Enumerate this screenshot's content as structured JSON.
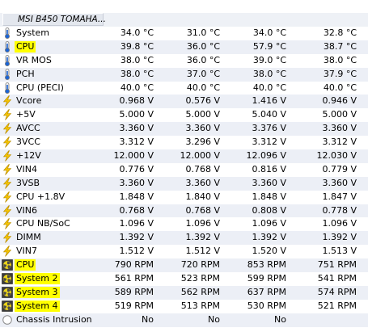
{
  "device": {
    "name": "MSI B450 TOMAHA..."
  },
  "rows": [
    {
      "label": "System",
      "icon": "thermometer-icon",
      "highlight": false,
      "values": [
        "34.0 °C",
        "31.0 °C",
        "34.0 °C",
        "32.8 °C"
      ]
    },
    {
      "label": "CPU",
      "icon": "thermometer-icon",
      "highlight": true,
      "values": [
        "39.8 °C",
        "36.0 °C",
        "57.9 °C",
        "38.7 °C"
      ]
    },
    {
      "label": "VR MOS",
      "icon": "thermometer-icon",
      "highlight": false,
      "values": [
        "38.0 °C",
        "36.0 °C",
        "39.0 °C",
        "38.0 °C"
      ]
    },
    {
      "label": "PCH",
      "icon": "thermometer-icon",
      "highlight": false,
      "values": [
        "38.0 °C",
        "37.0 °C",
        "38.0 °C",
        "37.9 °C"
      ]
    },
    {
      "label": "CPU (PECI)",
      "icon": "thermometer-icon",
      "highlight": false,
      "values": [
        "40.0 °C",
        "40.0 °C",
        "40.0 °C",
        "40.0 °C"
      ]
    },
    {
      "label": "Vcore",
      "icon": "lightning-icon",
      "highlight": false,
      "values": [
        "0.968 V",
        "0.576 V",
        "1.416 V",
        "0.946 V"
      ]
    },
    {
      "label": "+5V",
      "icon": "lightning-icon",
      "highlight": false,
      "values": [
        "5.000 V",
        "5.000 V",
        "5.040 V",
        "5.000 V"
      ]
    },
    {
      "label": "AVCC",
      "icon": "lightning-icon",
      "highlight": false,
      "values": [
        "3.360 V",
        "3.360 V",
        "3.376 V",
        "3.360 V"
      ]
    },
    {
      "label": "3VCC",
      "icon": "lightning-icon",
      "highlight": false,
      "values": [
        "3.312 V",
        "3.296 V",
        "3.312 V",
        "3.312 V"
      ]
    },
    {
      "label": "+12V",
      "icon": "lightning-icon",
      "highlight": false,
      "values": [
        "12.000 V",
        "12.000 V",
        "12.096 V",
        "12.030 V"
      ]
    },
    {
      "label": "VIN4",
      "icon": "lightning-icon",
      "highlight": false,
      "values": [
        "0.776 V",
        "0.768 V",
        "0.816 V",
        "0.779 V"
      ]
    },
    {
      "label": "3VSB",
      "icon": "lightning-icon",
      "highlight": false,
      "values": [
        "3.360 V",
        "3.360 V",
        "3.360 V",
        "3.360 V"
      ]
    },
    {
      "label": "CPU +1.8V",
      "icon": "lightning-icon",
      "highlight": false,
      "values": [
        "1.848 V",
        "1.840 V",
        "1.848 V",
        "1.847 V"
      ]
    },
    {
      "label": "VIN6",
      "icon": "lightning-icon",
      "highlight": false,
      "values": [
        "0.768 V",
        "0.768 V",
        "0.808 V",
        "0.778 V"
      ]
    },
    {
      "label": "CPU NB/SoC",
      "icon": "lightning-icon",
      "highlight": false,
      "values": [
        "1.096 V",
        "1.096 V",
        "1.096 V",
        "1.096 V"
      ]
    },
    {
      "label": "DIMM",
      "icon": "lightning-icon",
      "highlight": false,
      "values": [
        "1.392 V",
        "1.392 V",
        "1.392 V",
        "1.392 V"
      ]
    },
    {
      "label": "VIN7",
      "icon": "lightning-icon",
      "highlight": false,
      "values": [
        "1.512 V",
        "1.512 V",
        "1.520 V",
        "1.513 V"
      ]
    },
    {
      "label": "CPU",
      "icon": "fan-icon",
      "highlight": true,
      "values": [
        "790 RPM",
        "720 RPM",
        "853 RPM",
        "751 RPM"
      ]
    },
    {
      "label": "System 2",
      "icon": "fan-icon",
      "highlight": true,
      "values": [
        "561 RPM",
        "523 RPM",
        "599 RPM",
        "541 RPM"
      ]
    },
    {
      "label": "System 3",
      "icon": "fan-icon",
      "highlight": true,
      "values": [
        "589 RPM",
        "562 RPM",
        "637 RPM",
        "574 RPM"
      ]
    },
    {
      "label": "System 4",
      "icon": "fan-icon",
      "highlight": true,
      "values": [
        "519 RPM",
        "513 RPM",
        "530 RPM",
        "521 RPM"
      ]
    },
    {
      "label": "Chassis Intrusion",
      "icon": "circle-icon",
      "highlight": false,
      "values": [
        "No",
        "No",
        "No",
        ""
      ]
    }
  ]
}
